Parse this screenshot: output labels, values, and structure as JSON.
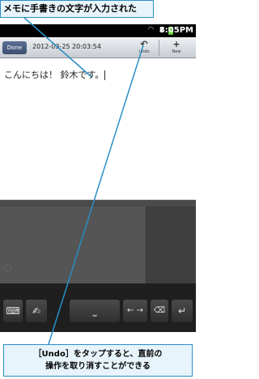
{
  "callouts": {
    "top": "メモに手書きの文字が入力された",
    "bottom_line1": "［Undo］をタップすると、直前の",
    "bottom_line2": "操作を取り消すことができる"
  },
  "statusbar": {
    "time": "8:05PM",
    "icons": "wifi-icon signal-icon battery-icon"
  },
  "toolbar": {
    "done_label": "Done",
    "timestamp": "2012-03-25 20:03:54",
    "undo_label": "Undo",
    "new_label": "New"
  },
  "note": {
    "text": "こんにちは！ 鈴木です。"
  },
  "keyboard": {
    "arrows_label": "← →",
    "delete_label": "⌫",
    "enter_label": "↵"
  },
  "colors": {
    "callout_border": "#2a8fc4",
    "callout_bg": "#e7f4fb",
    "leader_line": "#2a8fc4"
  }
}
